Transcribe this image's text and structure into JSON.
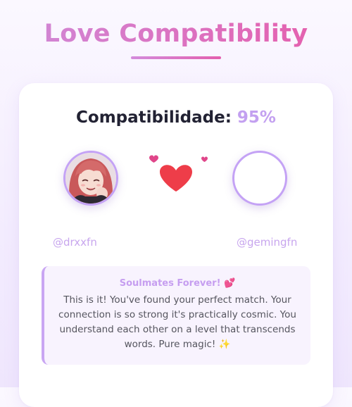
{
  "title": "Love Compatibility",
  "compat": {
    "label": "Compatibilidade:",
    "value": "95%"
  },
  "users": {
    "left": {
      "handle": "@drxxfn",
      "avatar": "anime-avatar-icon"
    },
    "right": {
      "handle": "@gemingfn",
      "avatar": "empty-avatar"
    }
  },
  "message": {
    "title": "Soulmates Forever! 💕",
    "body": "This is it! You've found your perfect match. Your connection is so strong it's practically cosmic. You understand each other on a level that transcends words. Pure magic! ✨"
  },
  "colors": {
    "accent": "#c3a0f0",
    "heart": "#ee3d49",
    "title_start": "#cf8ad9",
    "title_end": "#e65ba9"
  }
}
